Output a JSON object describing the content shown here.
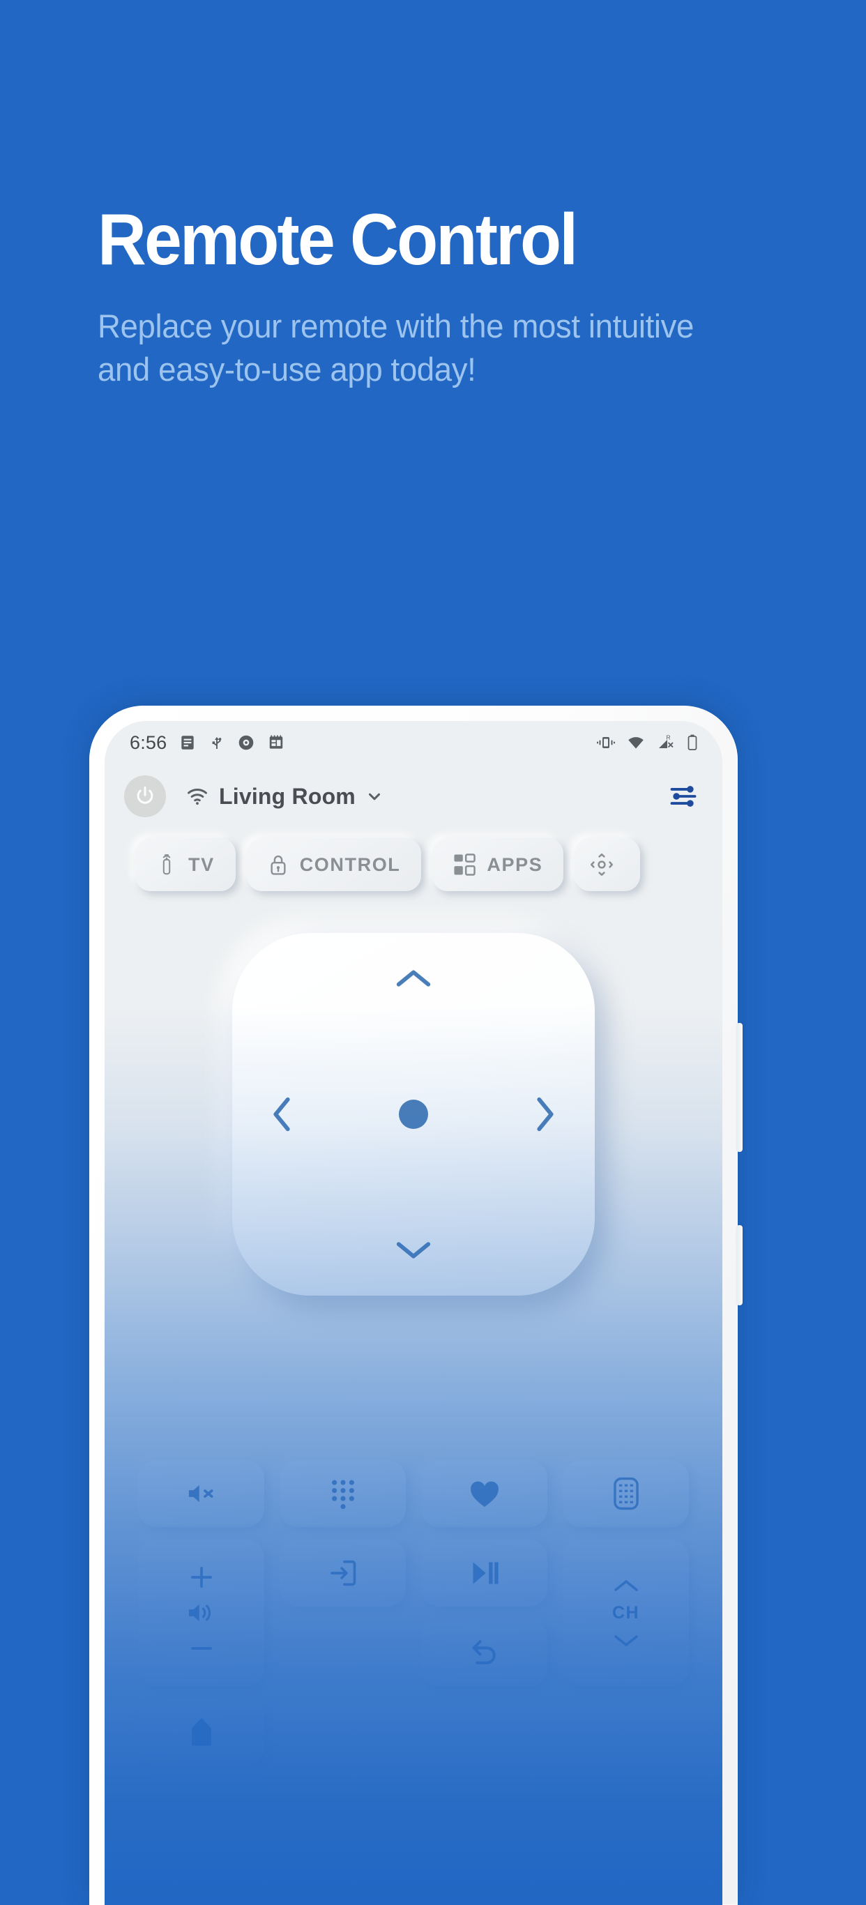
{
  "marketing": {
    "headline": "Remote Control",
    "subcopy": "Replace your remote with the most intuitive and easy-to-use app today!",
    "background_color": "#2167C3",
    "headline_color": "#FFFFFF",
    "subcopy_color": "#9CC4EE"
  },
  "phone": {
    "status_bar": {
      "time": "6:56",
      "left_icons": [
        "notes-icon",
        "usb-icon",
        "record-disc-icon",
        "calendar-icon"
      ],
      "right_icons": [
        "vibrate-icon",
        "wifi-icon",
        "cellular-off-roaming-icon",
        "battery-icon"
      ],
      "roaming_label": "R"
    },
    "app_header": {
      "power_button_label": "power-button",
      "connection_icon": "wifi-icon",
      "room_name": "Living Room",
      "room_chevron": "chevron-down-icon",
      "settings_icon": "sliders-icon",
      "settings_color": "#1E4B9E"
    },
    "tabs": [
      {
        "id": "tv",
        "label": "TV",
        "icon": "remote-stick-icon"
      },
      {
        "id": "control",
        "label": "CONTROL",
        "icon": "lock-icon"
      },
      {
        "id": "apps",
        "label": "APPS",
        "icon": "grid-icon"
      },
      {
        "id": "nav",
        "label": "",
        "icon": "dpad-icon"
      }
    ],
    "dpad": {
      "up": "chevron-up-icon",
      "down": "chevron-down-icon",
      "left": "chevron-left-icon",
      "right": "chevron-right-icon",
      "center": "ok-dot-button",
      "accent_color": "#4A7EB8"
    },
    "button_grid": [
      {
        "id": "mute",
        "icon": "volume-mute-icon",
        "label": ""
      },
      {
        "id": "keypad",
        "icon": "dialpad-icon",
        "label": ""
      },
      {
        "id": "favorite",
        "icon": "heart-icon",
        "label": ""
      },
      {
        "id": "keyboard",
        "icon": "keyboard-grid-icon",
        "label": ""
      },
      {
        "id": "volume-up",
        "icon": "plus-icon",
        "label": ""
      },
      {
        "id": "source",
        "icon": "input-source-icon",
        "label": ""
      },
      {
        "id": "play-pause",
        "icon": "play-pause-icon",
        "label": ""
      },
      {
        "id": "channel-up",
        "icon": "chevron-up-icon",
        "label": ""
      },
      {
        "id": "volume",
        "icon": "volume-icon",
        "label": ""
      },
      {
        "id": "back",
        "icon": "back-arrow-icon",
        "label": ""
      },
      {
        "id": "home",
        "icon": "home-icon",
        "label": ""
      },
      {
        "id": "channel",
        "icon": "",
        "label": "CH"
      },
      {
        "id": "volume-down",
        "icon": "minus-icon",
        "label": ""
      },
      {
        "id": "channel-down",
        "icon": "chevron-down-icon",
        "label": ""
      }
    ],
    "hardware": {
      "volume_rocker": "volume-rocker-button",
      "power_key": "power-key-button"
    }
  }
}
